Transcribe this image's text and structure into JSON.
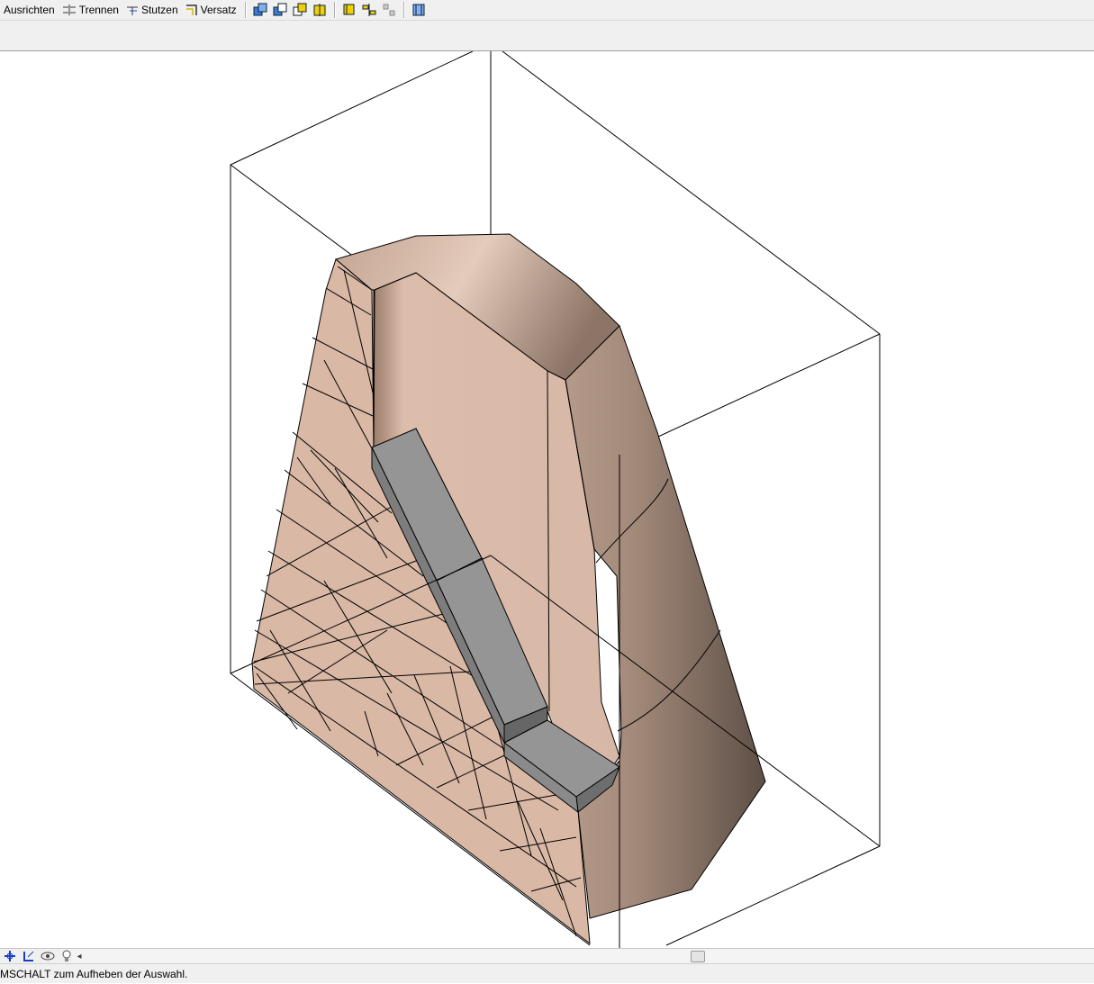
{
  "toolbar": {
    "align_label": "Ausrichten",
    "split_label": "Trennen",
    "trim_label": "Stutzen",
    "offset_label": "Versatz",
    "icons": [
      "union-icon",
      "subtract-icon",
      "intersect-icon",
      "slice-icon",
      "copy-face-icon",
      "mirror-icon",
      "array-icon",
      "measure-icon"
    ]
  },
  "bottom_toolbar": {
    "icons": [
      "snap-icon",
      "ucs-icon",
      "orbit-icon",
      "light-icon"
    ]
  },
  "scrollbar": {
    "left_arrow": "◂"
  },
  "status": {
    "message": "MSCHALT zum Aufheben der Auswahl."
  },
  "colors": {
    "solid_face": "#d8b9a6",
    "solid_shadow": "#9c8475",
    "gray_block": "#959595",
    "edge_line": "#000000"
  }
}
